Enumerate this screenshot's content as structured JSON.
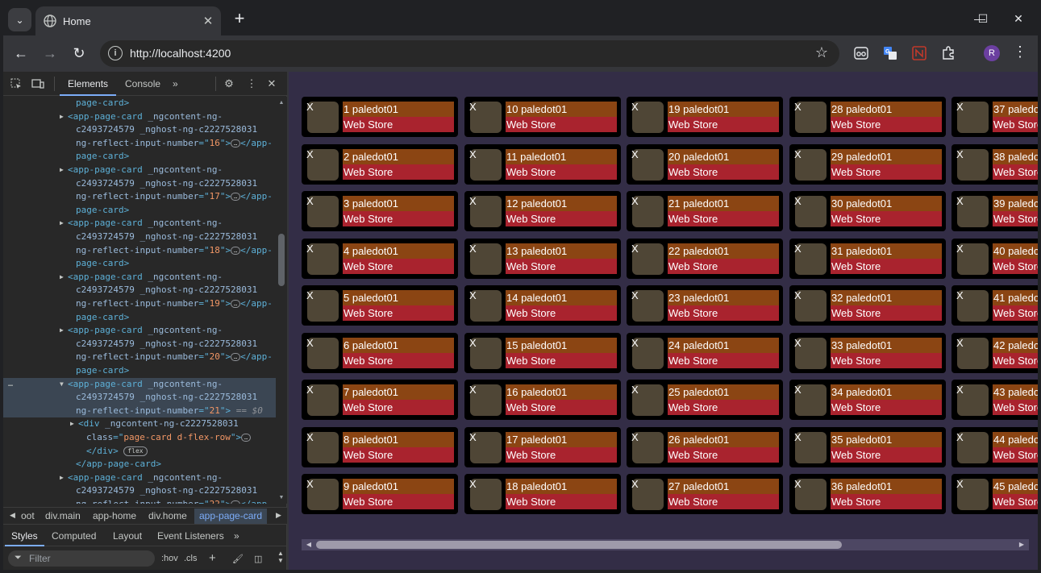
{
  "tab": {
    "title": "Home",
    "close": "✕",
    "new": "+"
  },
  "window_controls": {
    "minimize": "—",
    "maximize": "☐",
    "close": "✕"
  },
  "toolbar": {
    "back": "←",
    "forward": "→",
    "reload": "↻",
    "url": "http://localhost:4200",
    "star": "☆",
    "profile_initial": "R"
  },
  "devtools": {
    "tabs": {
      "elements": "Elements",
      "console": "Console",
      "more": "»"
    },
    "close": "✕",
    "dom_lines": [
      {
        "indent": 90,
        "parts": [
          [
            "tag",
            "page-card>"
          ]
        ]
      },
      {
        "indent": 80,
        "tri": "▶",
        "parts": [
          [
            "tag",
            "<app-page-card "
          ],
          [
            "attr-name",
            "_ngcontent-ng-"
          ]
        ]
      },
      {
        "indent": 90,
        "parts": [
          [
            "attr-name",
            "c2493724579 _nghost-ng-c2227528031"
          ]
        ]
      },
      {
        "indent": 90,
        "parts": [
          [
            "attr-name",
            "ng-reflect-input-number"
          ],
          [
            "tag",
            "=\""
          ],
          [
            "attr-val",
            "16"
          ],
          [
            "tag",
            "\">"
          ],
          [
            "pill",
            ""
          ],
          [
            "tag",
            "</app-"
          ]
        ]
      },
      {
        "indent": 90,
        "parts": [
          [
            "tag",
            "page-card>"
          ]
        ]
      },
      {
        "indent": 80,
        "tri": "▶",
        "parts": [
          [
            "tag",
            "<app-page-card "
          ],
          [
            "attr-name",
            "_ngcontent-ng-"
          ]
        ]
      },
      {
        "indent": 90,
        "parts": [
          [
            "attr-name",
            "c2493724579 _nghost-ng-c2227528031"
          ]
        ]
      },
      {
        "indent": 90,
        "parts": [
          [
            "attr-name",
            "ng-reflect-input-number"
          ],
          [
            "tag",
            "=\""
          ],
          [
            "attr-val",
            "17"
          ],
          [
            "tag",
            "\">"
          ],
          [
            "pill",
            ""
          ],
          [
            "tag",
            "</app-"
          ]
        ]
      },
      {
        "indent": 90,
        "parts": [
          [
            "tag",
            "page-card>"
          ]
        ]
      },
      {
        "indent": 80,
        "tri": "▶",
        "parts": [
          [
            "tag",
            "<app-page-card "
          ],
          [
            "attr-name",
            "_ngcontent-ng-"
          ]
        ]
      },
      {
        "indent": 90,
        "parts": [
          [
            "attr-name",
            "c2493724579 _nghost-ng-c2227528031"
          ]
        ]
      },
      {
        "indent": 90,
        "parts": [
          [
            "attr-name",
            "ng-reflect-input-number"
          ],
          [
            "tag",
            "=\""
          ],
          [
            "attr-val",
            "18"
          ],
          [
            "tag",
            "\">"
          ],
          [
            "pill",
            ""
          ],
          [
            "tag",
            "</app-"
          ]
        ]
      },
      {
        "indent": 90,
        "parts": [
          [
            "tag",
            "page-card>"
          ]
        ]
      },
      {
        "indent": 80,
        "tri": "▶",
        "parts": [
          [
            "tag",
            "<app-page-card "
          ],
          [
            "attr-name",
            "_ngcontent-ng-"
          ]
        ]
      },
      {
        "indent": 90,
        "parts": [
          [
            "attr-name",
            "c2493724579 _nghost-ng-c2227528031"
          ]
        ]
      },
      {
        "indent": 90,
        "parts": [
          [
            "attr-name",
            "ng-reflect-input-number"
          ],
          [
            "tag",
            "=\""
          ],
          [
            "attr-val",
            "19"
          ],
          [
            "tag",
            "\">"
          ],
          [
            "pill",
            ""
          ],
          [
            "tag",
            "</app-"
          ]
        ]
      },
      {
        "indent": 90,
        "parts": [
          [
            "tag",
            "page-card>"
          ]
        ]
      },
      {
        "indent": 80,
        "tri": "▶",
        "parts": [
          [
            "tag",
            "<app-page-card "
          ],
          [
            "attr-name",
            "_ngcontent-ng-"
          ]
        ]
      },
      {
        "indent": 90,
        "parts": [
          [
            "attr-name",
            "c2493724579 _nghost-ng-c2227528031"
          ]
        ]
      },
      {
        "indent": 90,
        "parts": [
          [
            "attr-name",
            "ng-reflect-input-number"
          ],
          [
            "tag",
            "=\""
          ],
          [
            "attr-val",
            "20"
          ],
          [
            "tag",
            "\">"
          ],
          [
            "pill",
            ""
          ],
          [
            "tag",
            "</app-"
          ]
        ]
      },
      {
        "indent": 90,
        "parts": [
          [
            "tag",
            "page-card>"
          ]
        ]
      },
      {
        "indent": 80,
        "tri": "▼",
        "selected": true,
        "dots": "…",
        "parts": [
          [
            "tag",
            "<app-page-card "
          ],
          [
            "attr-name",
            "_ngcontent-ng-"
          ]
        ]
      },
      {
        "indent": 90,
        "selected": true,
        "parts": [
          [
            "attr-name",
            "c2493724579 _nghost-ng-c2227528031"
          ]
        ]
      },
      {
        "indent": 90,
        "selected": true,
        "parts": [
          [
            "attr-name",
            "ng-reflect-input-number"
          ],
          [
            "tag",
            "=\""
          ],
          [
            "attr-val",
            "21"
          ],
          [
            "tag",
            "\">"
          ],
          [
            "pseudo",
            " == $0"
          ]
        ]
      },
      {
        "indent": 93,
        "tri": "▶",
        "parts": [
          [
            "tag",
            "<div "
          ],
          [
            "attr-name",
            "_ngcontent-ng-c2227528031"
          ]
        ]
      },
      {
        "indent": 103,
        "parts": [
          [
            "attr-name",
            "class"
          ],
          [
            "tag",
            "=\""
          ],
          [
            "attr-val",
            "page-card d-flex-row"
          ],
          [
            "tag",
            "\">"
          ],
          [
            "pill",
            ""
          ]
        ]
      },
      {
        "indent": 103,
        "parts": [
          [
            "tag",
            "</div> "
          ],
          [
            "badge",
            "flex"
          ]
        ]
      },
      {
        "indent": 90,
        "parts": [
          [
            "tag",
            "</app-page-card>"
          ]
        ]
      },
      {
        "indent": 80,
        "tri": "▶",
        "parts": [
          [
            "tag",
            "<app-page-card "
          ],
          [
            "attr-name",
            "_ngcontent-ng-"
          ]
        ]
      },
      {
        "indent": 90,
        "parts": [
          [
            "attr-name",
            "c2493724579 _nghost-ng-c2227528031"
          ]
        ]
      },
      {
        "indent": 90,
        "parts": [
          [
            "attr-name",
            "ng-reflect-input-number"
          ],
          [
            "tag",
            "=\""
          ],
          [
            "attr-val",
            "22"
          ],
          [
            "tag",
            "\">"
          ],
          [
            "pill",
            ""
          ],
          [
            "tag",
            "</app-"
          ]
        ]
      }
    ],
    "breadcrumbs": {
      "root_partial": "oot",
      "main": "div.main",
      "app_home": "app-home",
      "home": "div.home",
      "page_card": "app-page-card"
    },
    "styles_tabs": {
      "styles": "Styles",
      "computed": "Computed",
      "layout": "Layout",
      "listeners": "Event Listeners",
      "more": "»"
    },
    "filter": {
      "placeholder": "Filter",
      "hov": ":hov",
      "cls": ".cls"
    }
  },
  "page": {
    "card_x": "X",
    "name_suffix": "paledot01",
    "store_label": "Web Store",
    "columns": 5,
    "rows": 9,
    "colors": {
      "background": "#332d46",
      "card": "#000000",
      "thumb": "#4f4636",
      "name_bg": "#8b4513",
      "store_bg": "#a9232e"
    }
  }
}
